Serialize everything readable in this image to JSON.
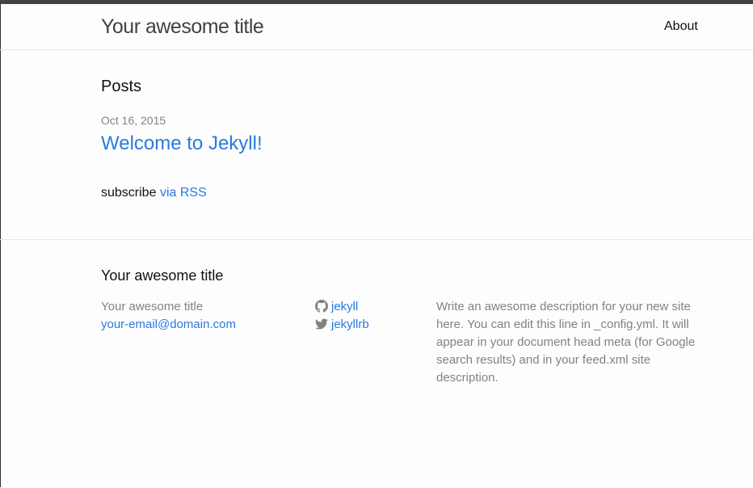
{
  "header": {
    "site_title": "Your awesome title",
    "nav": [
      {
        "label": "About"
      }
    ]
  },
  "main": {
    "heading": "Posts",
    "posts": [
      {
        "date": "Oct 16, 2015",
        "title": "Welcome to Jekyll!"
      }
    ],
    "rss": {
      "prefix": "subscribe",
      "link_label": "via RSS"
    }
  },
  "footer": {
    "heading": "Your awesome title",
    "contact": {
      "name": "Your awesome title",
      "email": "your-email@domain.com"
    },
    "social": [
      {
        "icon": "github-icon",
        "username": "jekyll"
      },
      {
        "icon": "twitter-icon",
        "username": "jekyllrb"
      }
    ],
    "description": "Write an awesome description for your new site here. You can edit this line in _config.yml. It will appear in your document head meta (for Google search results) and in your feed.xml site description."
  },
  "colors": {
    "link": "#2a7ae2",
    "meta": "#828282",
    "text": "#111111",
    "border": "#e8e8e8",
    "top_bar": "#424242"
  }
}
